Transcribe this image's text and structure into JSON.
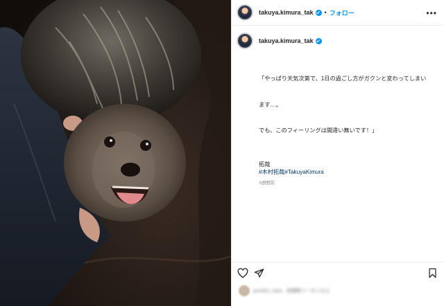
{
  "post": {
    "username": "takuya.kimura_tak",
    "follow_label": "フォロー",
    "separator": "•",
    "caption_lines": [
      "「やっぱり天気次第で、1日の過ごし方がガクンと変わってしまい",
      "ます…。",
      "でも、このフィーリングは間違い無いです！」"
    ],
    "signature": "拓哉",
    "hashtags": "#木村拓哉#TakuyaKimura",
    "timestamp": "3週間前",
    "liked_by": "ponoko_nara、他複数ツーセン以上"
  },
  "icons": {
    "verified": "verified-badge-icon",
    "more": "more-options-icon",
    "like": "heart-icon",
    "share": "send-icon",
    "save": "bookmark-icon"
  },
  "colors": {
    "accent": "#0095f6",
    "hashtag": "#00376b",
    "muted": "#8e8e8e"
  }
}
